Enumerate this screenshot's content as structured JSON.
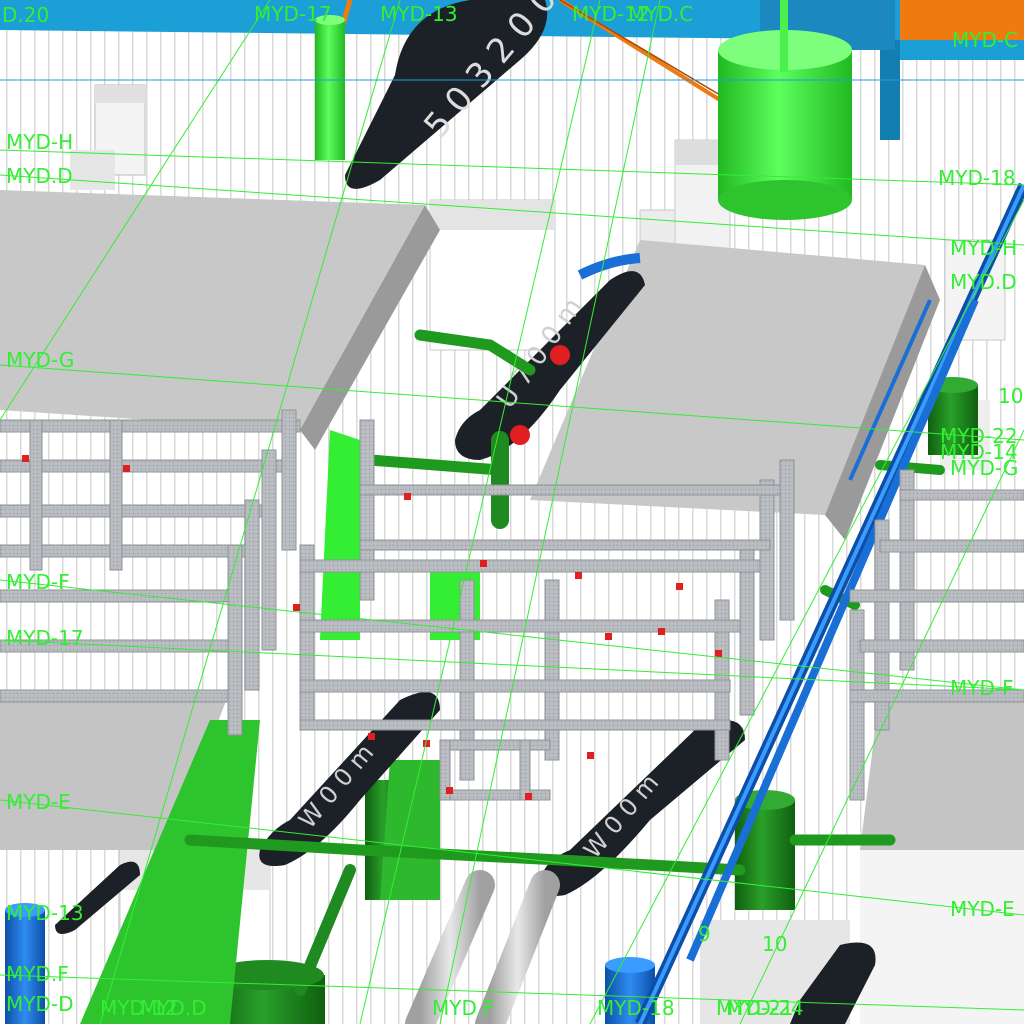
{
  "colors": {
    "background": "#ffffff",
    "grid_line": "#33ee33",
    "slab_gray": "#c8c8c8",
    "frame_gray": "#b4b8bc",
    "pipe_green": "#33cc33",
    "pipe_blue": "#1a6fd6",
    "duct_cyan": "#1b9fd6",
    "orange_pipe": "#ee7a10",
    "label_dark": "#1c2127",
    "clamp_red": "#e02020"
  },
  "grid_labels": {
    "top_1": "MYD-17",
    "top_2": "MYD-13",
    "top_3": "MYD-12",
    "top_4": "MYD.C",
    "top_right": "MYD-C",
    "top_left_partial": "D.20",
    "left_h": "MYD-H",
    "left_d": "MYD.D",
    "left_g": "MYD-G",
    "left_f": "MYD-F",
    "left_17": "MYD-17",
    "left_e": "MYD-E",
    "left_13": "MYD-13",
    "left_f2": "MYD.F",
    "left_d2": "MYD-D",
    "right_18": "MYD-18",
    "right_h": "MYD-H",
    "right_d": "MYD.D",
    "right_22": "MYD-22",
    "right_14": "MYD-14",
    "right_g": "MYD-G",
    "right_f": "MYD-F",
    "right_e": "MYD-E",
    "bottom_1": "MYD-12",
    "bottom_2": "MYD.D",
    "bottom_3": "MYD.F",
    "bottom_4": "MYD-18",
    "bottom_5": "MYD-21",
    "bottom_6": "MYD-24"
  },
  "grid_numbers": {
    "n_10_right": "10",
    "n_9": "9",
    "n_10_bottom": "10"
  },
  "tag_text": {
    "tag_top": "5 0 3 2 0 0 m",
    "tag_mid": "U 7 0 0 m",
    "tag_bottom_left": "W 0 0 m",
    "tag_bottom_mid": "W 0 0 m"
  }
}
